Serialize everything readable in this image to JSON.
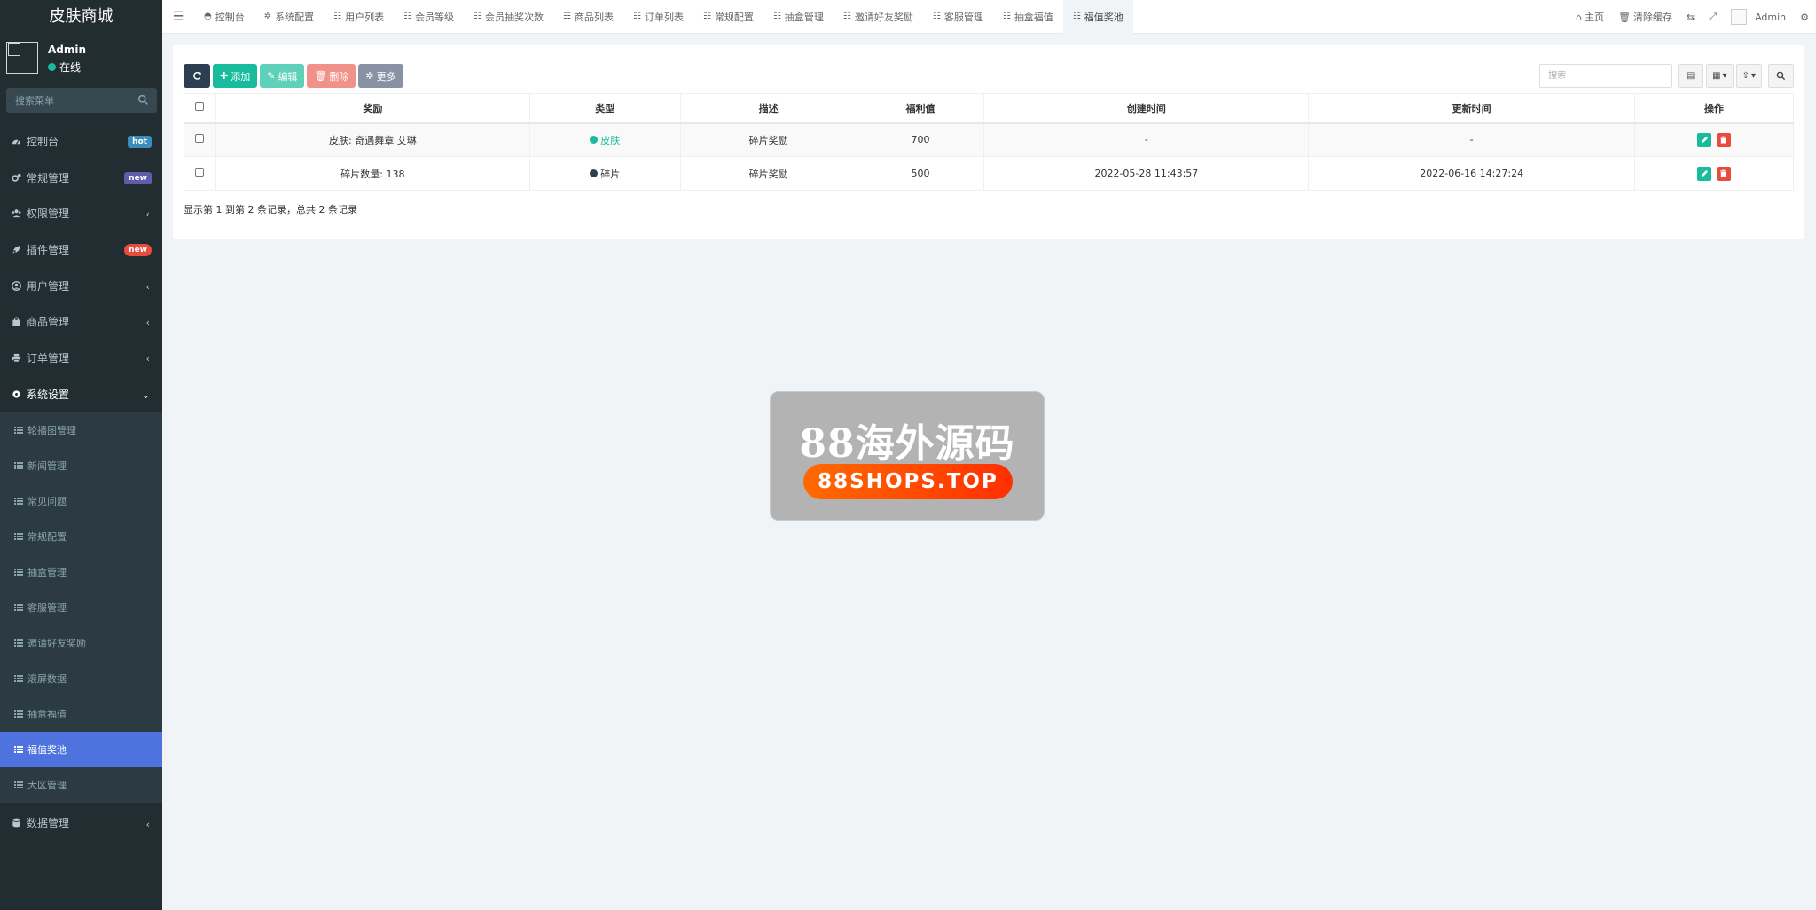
{
  "app": {
    "title": "皮肤商城"
  },
  "user": {
    "name": "Admin",
    "status": "在线"
  },
  "sidebar": {
    "search_placeholder": "搜索菜单",
    "items": [
      {
        "label": "控制台",
        "badge": "hot"
      },
      {
        "label": "常规管理",
        "badge": "new"
      },
      {
        "label": "权限管理"
      },
      {
        "label": "插件管理",
        "badge": "new"
      },
      {
        "label": "用户管理"
      },
      {
        "label": "商品管理"
      },
      {
        "label": "订单管理"
      },
      {
        "label": "系统设置"
      }
    ],
    "sub_items": [
      {
        "label": "轮播图管理"
      },
      {
        "label": "新闻管理"
      },
      {
        "label": "常见问题"
      },
      {
        "label": "常规配置"
      },
      {
        "label": "抽盒管理"
      },
      {
        "label": "客服管理"
      },
      {
        "label": "邀请好友奖励"
      },
      {
        "label": "滚屏数据"
      },
      {
        "label": "抽盒福值"
      },
      {
        "label": "福值奖池"
      },
      {
        "label": "大区管理"
      }
    ],
    "last_item": {
      "label": "数据管理"
    }
  },
  "navbar": {
    "tabs": [
      {
        "label": "控制台"
      },
      {
        "label": "系统配置"
      },
      {
        "label": "用户列表"
      },
      {
        "label": "会员等级"
      },
      {
        "label": "会员抽奖次数"
      },
      {
        "label": "商品列表"
      },
      {
        "label": "订单列表"
      },
      {
        "label": "常规配置"
      },
      {
        "label": "抽盒管理"
      },
      {
        "label": "邀请好友奖励"
      },
      {
        "label": "客服管理"
      },
      {
        "label": "抽盒福值"
      },
      {
        "label": "福值奖池"
      }
    ],
    "home_label": "主页",
    "clear_cache_label": "清除缓存",
    "admin_label": "Admin"
  },
  "toolbar": {
    "add_label": "添加",
    "edit_label": "编辑",
    "delete_label": "删除",
    "more_label": "更多",
    "search_placeholder": "搜索"
  },
  "table": {
    "columns": [
      "奖励",
      "类型",
      "描述",
      "福利值",
      "创建时间",
      "更新时间",
      "操作"
    ],
    "rows": [
      {
        "reward": "皮肤: 奇遇舞章 艾琳",
        "type": "皮肤",
        "type_color": "#18bc9c",
        "desc": "碎片奖励",
        "value": "700",
        "created": "-",
        "updated": "-"
      },
      {
        "reward": "碎片数量: 138",
        "type": "碎片",
        "type_color": "#2c3e50",
        "desc": "碎片奖励",
        "value": "500",
        "created": "2022-05-28 11:43:57",
        "updated": "2022-06-16 14:27:24"
      }
    ],
    "pager_info": "显示第 1 到第 2 条记录，总共 2 条记录"
  },
  "watermark": {
    "title": "88海外源码",
    "url": "88SHOPS.TOP"
  }
}
